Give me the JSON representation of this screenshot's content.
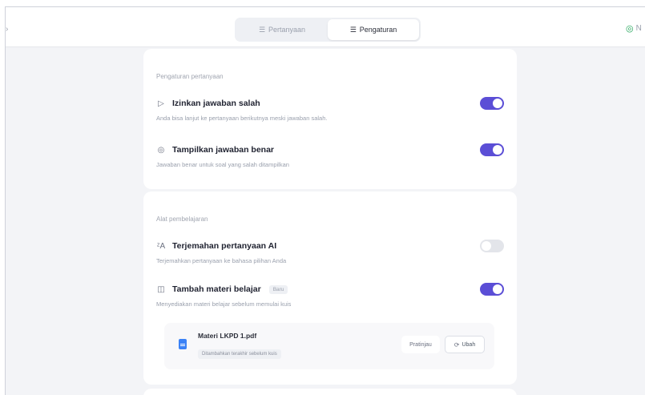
{
  "header": {
    "edge_glyph": "›",
    "tabs": [
      {
        "icon": "☰",
        "label": "Pertanyaan",
        "active": false
      },
      {
        "icon": "☰",
        "label": "Pengaturan",
        "active": true
      }
    ],
    "status_icon": "◎",
    "status_text": "N"
  },
  "question_settings": {
    "section_label": "Pengaturan pertanyaan",
    "rows": [
      {
        "icon": "▷",
        "title": "Izinkan jawaban salah",
        "description": "Anda bisa lanjut ke pertanyaan berikutnya meski jawaban salah.",
        "enabled": true
      },
      {
        "icon": "◎",
        "title": "Tampilkan jawaban benar",
        "description": "Jawaban benar untuk soal yang salah ditampilkan",
        "enabled": true
      }
    ]
  },
  "learning_tools": {
    "section_label": "Alat pembelajaran",
    "rows": [
      {
        "icon": "ᶻA",
        "title": "Terjemahan pertanyaan AI",
        "description": "Terjemahkan pertanyaan ke bahasa pilihan Anda",
        "enabled": false
      },
      {
        "icon": "◫",
        "title": "Tambah materi belajar",
        "badge": "Baru",
        "description": "Menyediakan materi belajar sebelum memulai kuis",
        "enabled": true
      }
    ],
    "file": {
      "icon": "document-icon",
      "name": "Materi LKPD 1.pdf",
      "note": "Ditambahkan terakhir sebelum kuis",
      "preview_label": "Pratinjau",
      "change_icon": "⟳",
      "change_label": "Ubah"
    }
  },
  "colors": {
    "accent": "#5b4ed6",
    "toggle_off": "#e3e5ea",
    "file_icon": "#3b82f6",
    "status": "#22a55a"
  }
}
